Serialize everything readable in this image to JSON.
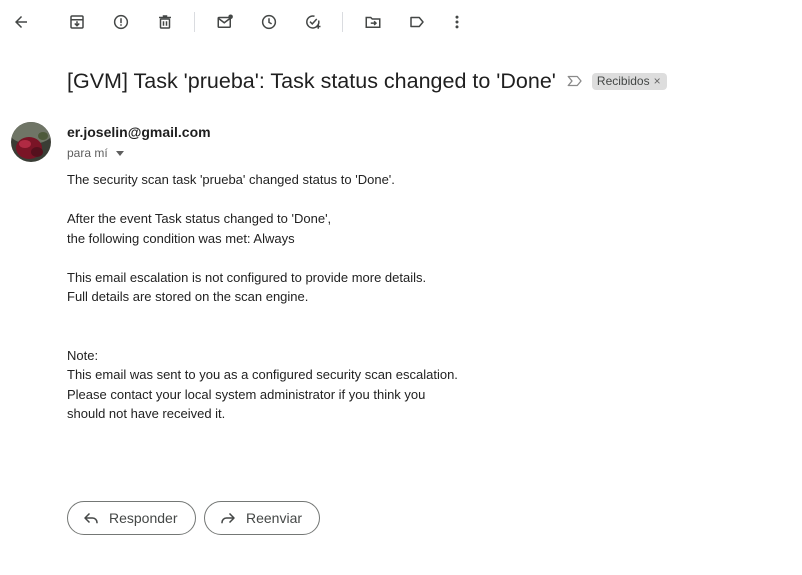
{
  "toolbar": {
    "buttons": [
      {
        "name": "back",
        "icon": "arrow-left-icon"
      },
      {
        "name": "archive",
        "icon": "archive-icon"
      },
      {
        "name": "report-spam",
        "icon": "report-spam-icon"
      },
      {
        "name": "delete",
        "icon": "trash-icon"
      },
      {
        "name": "mark-unread",
        "icon": "mark-unread-icon"
      },
      {
        "name": "snooze",
        "icon": "clock-icon"
      },
      {
        "name": "add-to-tasks",
        "icon": "add-task-icon"
      },
      {
        "name": "move-to",
        "icon": "folder-move-icon"
      },
      {
        "name": "labels",
        "icon": "label-icon"
      },
      {
        "name": "more",
        "icon": "more-vertical-icon"
      }
    ]
  },
  "email": {
    "subject": "[GVM] Task 'prueba': Task status changed to 'Done'",
    "label": "Recibidos",
    "label_remove": "×",
    "sender": "er.joselin@gmail.com",
    "recipient_summary": "para mí",
    "body_lines": [
      "The security scan task 'prueba' changed status to 'Done'.",
      "",
      "After the event Task status changed to 'Done',",
      "the following condition was met: Always",
      "",
      "This email escalation is not configured to provide more details.",
      "Full details are stored on the scan engine.",
      "",
      "",
      "Note:",
      "This email was sent to you as a configured security scan escalation.",
      "Please contact your local system administrator if you think you",
      "should not have received it."
    ]
  },
  "actions": {
    "reply_label": "Responder",
    "forward_label": "Reenviar"
  },
  "colors": {
    "icon": "#444746",
    "label_chip": "#dddddd",
    "button_border": "#747775"
  }
}
